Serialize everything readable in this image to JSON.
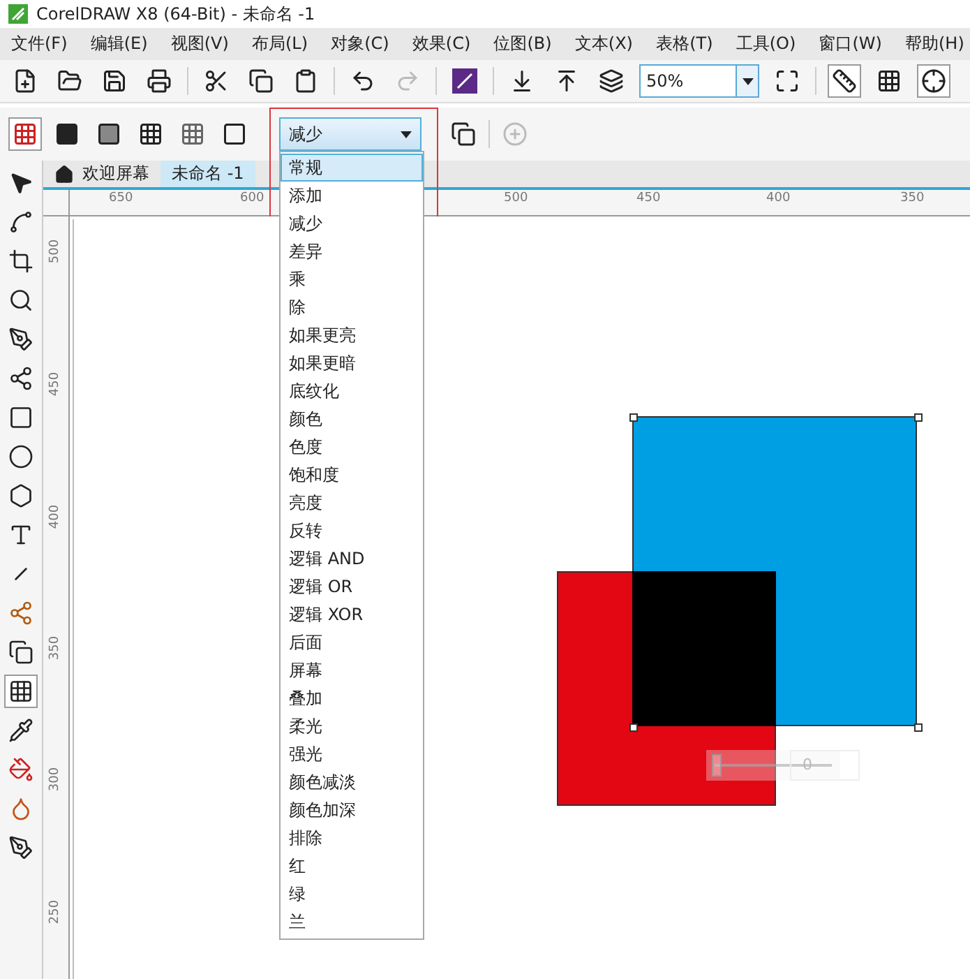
{
  "window": {
    "title": "CorelDRAW X8 (64-Bit) - 未命名 -1"
  },
  "menu": [
    "文件(F)",
    "编辑(E)",
    "视图(V)",
    "布局(L)",
    "对象(C)",
    "效果(C)",
    "位图(B)",
    "文本(X)",
    "表格(T)",
    "工具(O)",
    "窗口(W)",
    "帮助(H)"
  ],
  "toolbar": {
    "zoom": "50%"
  },
  "property_bar": {
    "merge_mode": "减少",
    "options": [
      {
        "label": "常规",
        "selected": true
      },
      {
        "label": "添加",
        "selected": false
      },
      {
        "label": "减少",
        "selected": false
      },
      {
        "label": "差异",
        "selected": false
      },
      {
        "label": "乘",
        "selected": false
      },
      {
        "label": "除",
        "selected": false
      },
      {
        "label": "如果更亮",
        "selected": false
      },
      {
        "label": "如果更暗",
        "selected": false
      },
      {
        "label": "底纹化",
        "selected": false
      },
      {
        "label": "颜色",
        "selected": false
      },
      {
        "label": "色度",
        "selected": false
      },
      {
        "label": "饱和度",
        "selected": false
      },
      {
        "label": "亮度",
        "selected": false
      },
      {
        "label": "反转",
        "selected": false
      },
      {
        "label": "逻辑 AND",
        "selected": false
      },
      {
        "label": "逻辑 OR",
        "selected": false
      },
      {
        "label": "逻辑 XOR",
        "selected": false
      },
      {
        "label": "后面",
        "selected": false
      },
      {
        "label": "屏幕",
        "selected": false
      },
      {
        "label": "叠加",
        "selected": false
      },
      {
        "label": "柔光",
        "selected": false
      },
      {
        "label": "强光",
        "selected": false
      },
      {
        "label": "颜色减淡",
        "selected": false
      },
      {
        "label": "颜色加深",
        "selected": false
      },
      {
        "label": "排除",
        "selected": false
      },
      {
        "label": "红",
        "selected": false
      },
      {
        "label": "绿",
        "selected": false
      },
      {
        "label": "兰",
        "selected": false
      }
    ]
  },
  "tabs": [
    {
      "label": "欢迎屏幕",
      "selected": false,
      "kind": "home"
    },
    {
      "label": "未命名 -1",
      "selected": true,
      "kind": "document"
    }
  ],
  "tools": [
    {
      "kind": "pick",
      "selected": false
    },
    {
      "kind": "shape",
      "selected": false
    },
    {
      "kind": "crop",
      "selected": false
    },
    {
      "kind": "zoom",
      "selected": false
    },
    {
      "kind": "freehand",
      "selected": false
    },
    {
      "kind": "artistic",
      "selected": false
    },
    {
      "kind": "rectangle",
      "selected": false
    },
    {
      "kind": "ellipse",
      "selected": false
    },
    {
      "kind": "polygon",
      "selected": false
    },
    {
      "kind": "text",
      "selected": false
    },
    {
      "kind": "dimension",
      "selected": false
    },
    {
      "kind": "connector",
      "selected": false
    },
    {
      "kind": "shadow",
      "selected": false
    },
    {
      "kind": "transparency",
      "selected": true
    },
    {
      "kind": "eyedropper",
      "selected": false
    },
    {
      "kind": "fill",
      "selected": false
    },
    {
      "kind": "smartfill",
      "selected": false
    },
    {
      "kind": "outline",
      "selected": false
    }
  ],
  "ruler": {
    "horizontal": [
      "650",
      "600",
      "500",
      "450",
      "400",
      "350"
    ],
    "vertical": [
      "500",
      "450",
      "400",
      "350",
      "300",
      "250"
    ]
  },
  "transparency_slider": {
    "level": 0,
    "reading": "0"
  }
}
